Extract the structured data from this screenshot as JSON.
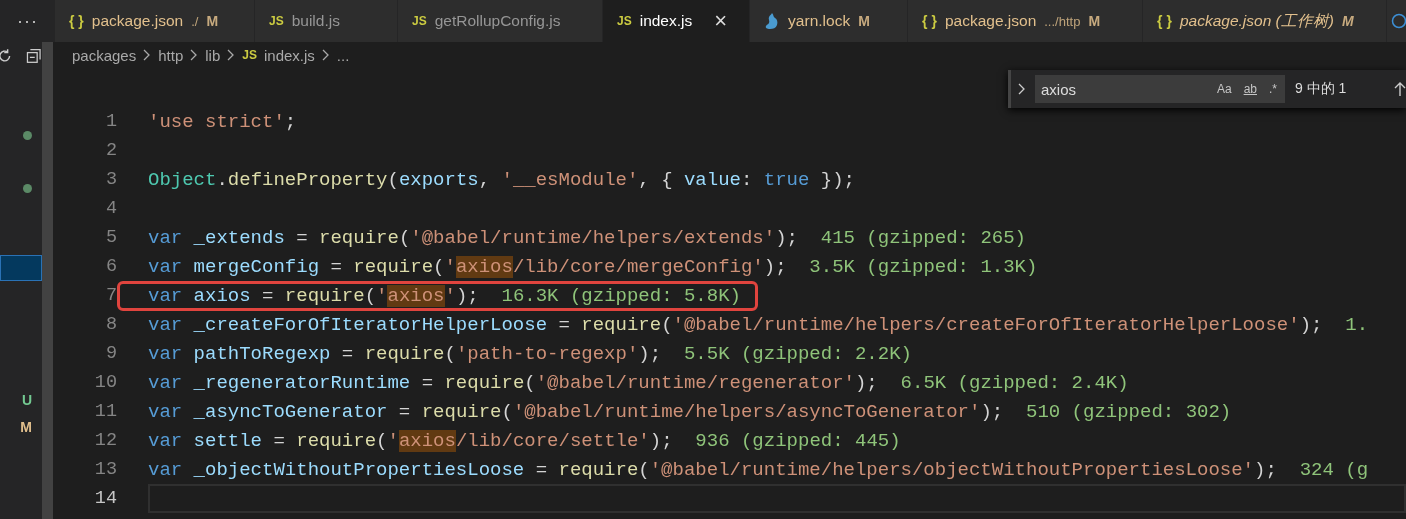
{
  "sidebar": {
    "more_label": "···",
    "rows": [
      {
        "kind": "plain",
        "selected": false
      },
      {
        "kind": "plain",
        "selected": false
      },
      {
        "kind": "dot",
        "color": "#5b8a66",
        "selected": false
      },
      {
        "kind": "plain",
        "selected": false
      },
      {
        "kind": "dot",
        "color": "#5b8a66",
        "selected": false
      },
      {
        "kind": "plain",
        "selected": false
      },
      {
        "kind": "plain",
        "selected": false
      },
      {
        "kind": "plain",
        "selected": true
      },
      {
        "kind": "plain",
        "selected": false
      },
      {
        "kind": "plain",
        "selected": false
      },
      {
        "kind": "plain",
        "selected": false
      },
      {
        "kind": "plain",
        "selected": false
      },
      {
        "kind": "letter",
        "text": "U",
        "color": "#73c991",
        "selected": false
      },
      {
        "kind": "letter",
        "text": "M",
        "color": "#e2c08d",
        "selected": false
      }
    ]
  },
  "tabs": [
    {
      "icon": {
        "kind": "glyph",
        "text": "{ }"
      },
      "label": "package.json",
      "description": "./",
      "badge": "M",
      "modified": true,
      "italic": false,
      "selected": false
    },
    {
      "icon": {
        "kind": "glyph",
        "text": "JS"
      },
      "label": "build.js",
      "modified": false,
      "italic": false,
      "selected": false
    },
    {
      "icon": {
        "kind": "glyph",
        "text": "JS"
      },
      "label": "getRollupConfig.js",
      "modified": false,
      "italic": false,
      "selected": false
    },
    {
      "icon": {
        "kind": "glyph",
        "text": "JS"
      },
      "label": "index.js",
      "close": "×",
      "modified": false,
      "italic": false,
      "selected": true
    },
    {
      "icon": {
        "kind": "yarn"
      },
      "label": "yarn.lock",
      "badge": "M",
      "modified": true,
      "italic": false,
      "selected": false
    },
    {
      "icon": {
        "kind": "glyph",
        "text": "{ }"
      },
      "label": "package.json",
      "description": ".../http",
      "badge": "M",
      "modified": true,
      "italic": false,
      "selected": false
    },
    {
      "icon": {
        "kind": "glyph",
        "text": "{ }"
      },
      "label": "package.json (工作树)",
      "badge": "M",
      "modified": true,
      "italic": true,
      "selected": false
    }
  ],
  "breadcrumbs": [
    {
      "text": "packages"
    },
    {
      "text": "http"
    },
    {
      "text": "lib"
    },
    {
      "text": "index.js",
      "icon": "JS"
    },
    {
      "text": "..."
    }
  ],
  "find": {
    "value": "axios",
    "options": [
      {
        "text": "Aa",
        "on": false
      },
      {
        "text": "ab",
        "on": false
      },
      {
        "text": ".*",
        "on": false
      }
    ],
    "count": "9 中的 1",
    "expanded": false
  },
  "lines": [
    {
      "number": "1",
      "current": false,
      "annotated": false,
      "tokens": [
        {
          "kind": "str",
          "text": "'use strict'"
        },
        {
          "kind": "punct",
          "text": ";"
        }
      ]
    },
    {
      "number": "2",
      "current": false,
      "annotated": false
    },
    {
      "number": "3",
      "current": false,
      "annotated": false,
      "tokens": [
        {
          "kind": "cls",
          "text": "Object"
        },
        {
          "kind": "punct",
          "text": "."
        },
        {
          "kind": "fn",
          "text": "defineProperty"
        },
        {
          "kind": "punct",
          "text": "("
        },
        {
          "kind": "var",
          "text": "exports"
        },
        {
          "kind": "punct",
          "text": ", "
        },
        {
          "kind": "str",
          "text": "'__esModule'"
        },
        {
          "kind": "punct",
          "text": ", { "
        },
        {
          "kind": "var",
          "text": "value"
        },
        {
          "kind": "punct",
          "text": ": "
        },
        {
          "kind": "kw",
          "text": "true"
        },
        {
          "kind": "punct",
          "text": " });"
        }
      ]
    },
    {
      "number": "4",
      "current": false,
      "annotated": false
    },
    {
      "number": "5",
      "current": false,
      "annotated": false,
      "tokens": [
        {
          "kind": "kw",
          "text": "var "
        },
        {
          "kind": "var",
          "text": "_extends"
        },
        {
          "kind": "punct",
          "text": " = "
        },
        {
          "kind": "fn",
          "text": "require"
        },
        {
          "kind": "punct",
          "text": "("
        },
        {
          "kind": "str",
          "text": "'@babel/runtime/helpers/extends'"
        },
        {
          "kind": "punct",
          "text": ");  "
        },
        {
          "kind": "size",
          "text": "415 (gzipped: 265)"
        }
      ]
    },
    {
      "number": "6",
      "current": false,
      "annotated": false,
      "tokens": [
        {
          "kind": "kw",
          "text": "var "
        },
        {
          "kind": "var",
          "text": "mergeConfig"
        },
        {
          "kind": "punct",
          "text": " = "
        },
        {
          "kind": "fn",
          "text": "require"
        },
        {
          "kind": "punct",
          "text": "("
        },
        {
          "kind": "str",
          "text": "'"
        },
        {
          "kind": "match",
          "text": "axios"
        },
        {
          "kind": "str",
          "text": "/lib/core/mergeConfig'"
        },
        {
          "kind": "punct",
          "text": ");  "
        },
        {
          "kind": "size",
          "text": "3.5K (gzipped: 1.3K)"
        }
      ]
    },
    {
      "number": "7",
      "current": false,
      "annotated": true,
      "tokens": [
        {
          "kind": "kw",
          "text": "var "
        },
        {
          "kind": "var",
          "text": "axios"
        },
        {
          "kind": "punct",
          "text": " = "
        },
        {
          "kind": "fn",
          "text": "require"
        },
        {
          "kind": "punct",
          "text": "("
        },
        {
          "kind": "str",
          "text": "'"
        },
        {
          "kind": "match",
          "text": "axios"
        },
        {
          "kind": "str",
          "text": "'"
        },
        {
          "kind": "punct",
          "text": ");  "
        },
        {
          "kind": "size",
          "text": "16.3K (gzipped: 5.8K)"
        }
      ]
    },
    {
      "number": "8",
      "current": false,
      "annotated": false,
      "tokens": [
        {
          "kind": "kw",
          "text": "var "
        },
        {
          "kind": "var",
          "text": "_createForOfIteratorHelperLoose"
        },
        {
          "kind": "punct",
          "text": " = "
        },
        {
          "kind": "fn",
          "text": "require"
        },
        {
          "kind": "punct",
          "text": "("
        },
        {
          "kind": "str",
          "text": "'@babel/runtime/helpers/createForOfIteratorHelperLoose'"
        },
        {
          "kind": "punct",
          "text": ");  "
        },
        {
          "kind": "size",
          "text": "1."
        }
      ]
    },
    {
      "number": "9",
      "current": false,
      "annotated": false,
      "tokens": [
        {
          "kind": "kw",
          "text": "var "
        },
        {
          "kind": "var",
          "text": "pathToRegexp"
        },
        {
          "kind": "punct",
          "text": " = "
        },
        {
          "kind": "fn",
          "text": "require"
        },
        {
          "kind": "punct",
          "text": "("
        },
        {
          "kind": "str",
          "text": "'path-to-regexp'"
        },
        {
          "kind": "punct",
          "text": ");  "
        },
        {
          "kind": "size",
          "text": "5.5K (gzipped: 2.2K)"
        }
      ]
    },
    {
      "number": "10",
      "current": false,
      "annotated": false,
      "tokens": [
        {
          "kind": "kw",
          "text": "var "
        },
        {
          "kind": "var",
          "text": "_regeneratorRuntime"
        },
        {
          "kind": "punct",
          "text": " = "
        },
        {
          "kind": "fn",
          "text": "require"
        },
        {
          "kind": "punct",
          "text": "("
        },
        {
          "kind": "str",
          "text": "'@babel/runtime/regenerator'"
        },
        {
          "kind": "punct",
          "text": ");  "
        },
        {
          "kind": "size",
          "text": "6.5K (gzipped: 2.4K)"
        }
      ]
    },
    {
      "number": "11",
      "current": false,
      "annotated": false,
      "tokens": [
        {
          "kind": "kw",
          "text": "var "
        },
        {
          "kind": "var",
          "text": "_asyncToGenerator"
        },
        {
          "kind": "punct",
          "text": " = "
        },
        {
          "kind": "fn",
          "text": "require"
        },
        {
          "kind": "punct",
          "text": "("
        },
        {
          "kind": "str",
          "text": "'@babel/runtime/helpers/asyncToGenerator'"
        },
        {
          "kind": "punct",
          "text": ");  "
        },
        {
          "kind": "size",
          "text": "510 (gzipped: 302)"
        }
      ]
    },
    {
      "number": "12",
      "current": false,
      "annotated": false,
      "tokens": [
        {
          "kind": "kw",
          "text": "var "
        },
        {
          "kind": "var",
          "text": "settle"
        },
        {
          "kind": "punct",
          "text": " = "
        },
        {
          "kind": "fn",
          "text": "require"
        },
        {
          "kind": "punct",
          "text": "("
        },
        {
          "kind": "str",
          "text": "'"
        },
        {
          "kind": "match",
          "text": "axios"
        },
        {
          "kind": "str",
          "text": "/lib/core/settle'"
        },
        {
          "kind": "punct",
          "text": ");  "
        },
        {
          "kind": "size",
          "text": "936 (gzipped: 445)"
        }
      ]
    },
    {
      "number": "13",
      "current": false,
      "annotated": false,
      "tokens": [
        {
          "kind": "kw",
          "text": "var "
        },
        {
          "kind": "var",
          "text": "_objectWithoutPropertiesLoose"
        },
        {
          "kind": "punct",
          "text": " = "
        },
        {
          "kind": "fn",
          "text": "require"
        },
        {
          "kind": "punct",
          "text": "("
        },
        {
          "kind": "str",
          "text": "'@babel/runtime/helpers/objectWithoutPropertiesLoose'"
        },
        {
          "kind": "punct",
          "text": ");  "
        },
        {
          "kind": "size",
          "text": "324 (g"
        }
      ]
    },
    {
      "number": "14",
      "current": true,
      "annotated": false
    }
  ]
}
